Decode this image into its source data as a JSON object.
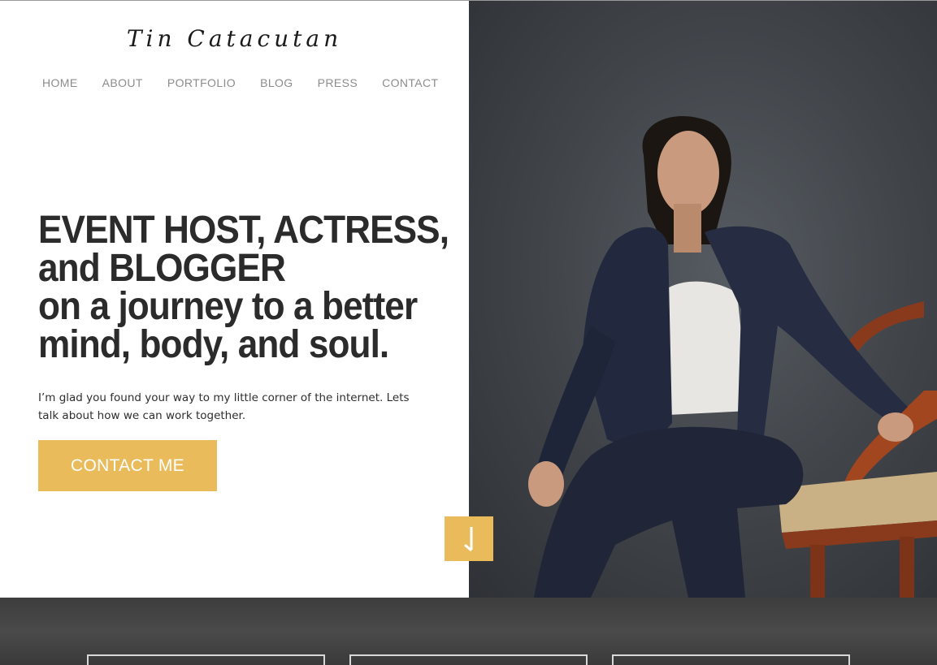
{
  "header": {
    "logo_text": "Tin Catacutan"
  },
  "nav": {
    "items": [
      {
        "label": "HOME"
      },
      {
        "label": "ABOUT"
      },
      {
        "label": "PORTFOLIO"
      },
      {
        "label": "BLOG"
      },
      {
        "label": "PRESS"
      },
      {
        "label": "CONTACT"
      }
    ]
  },
  "hero": {
    "headline_lines": [
      "EVENT HOST, ACTRESS,",
      "and BLOGGER",
      "on a journey to a better",
      "mind, body, and soul."
    ],
    "intro": "I’m glad you found your way to my little corner of the internet. Lets talk about how we can work together.",
    "cta_label": "CONTACT ME"
  },
  "colors": {
    "accent": "#eabb5b",
    "heading": "#2b2b2b",
    "nav_text": "#8c8c8c",
    "bottom_band": "#444444"
  },
  "icons": {
    "scroll_down": "arrow-down-icon"
  }
}
